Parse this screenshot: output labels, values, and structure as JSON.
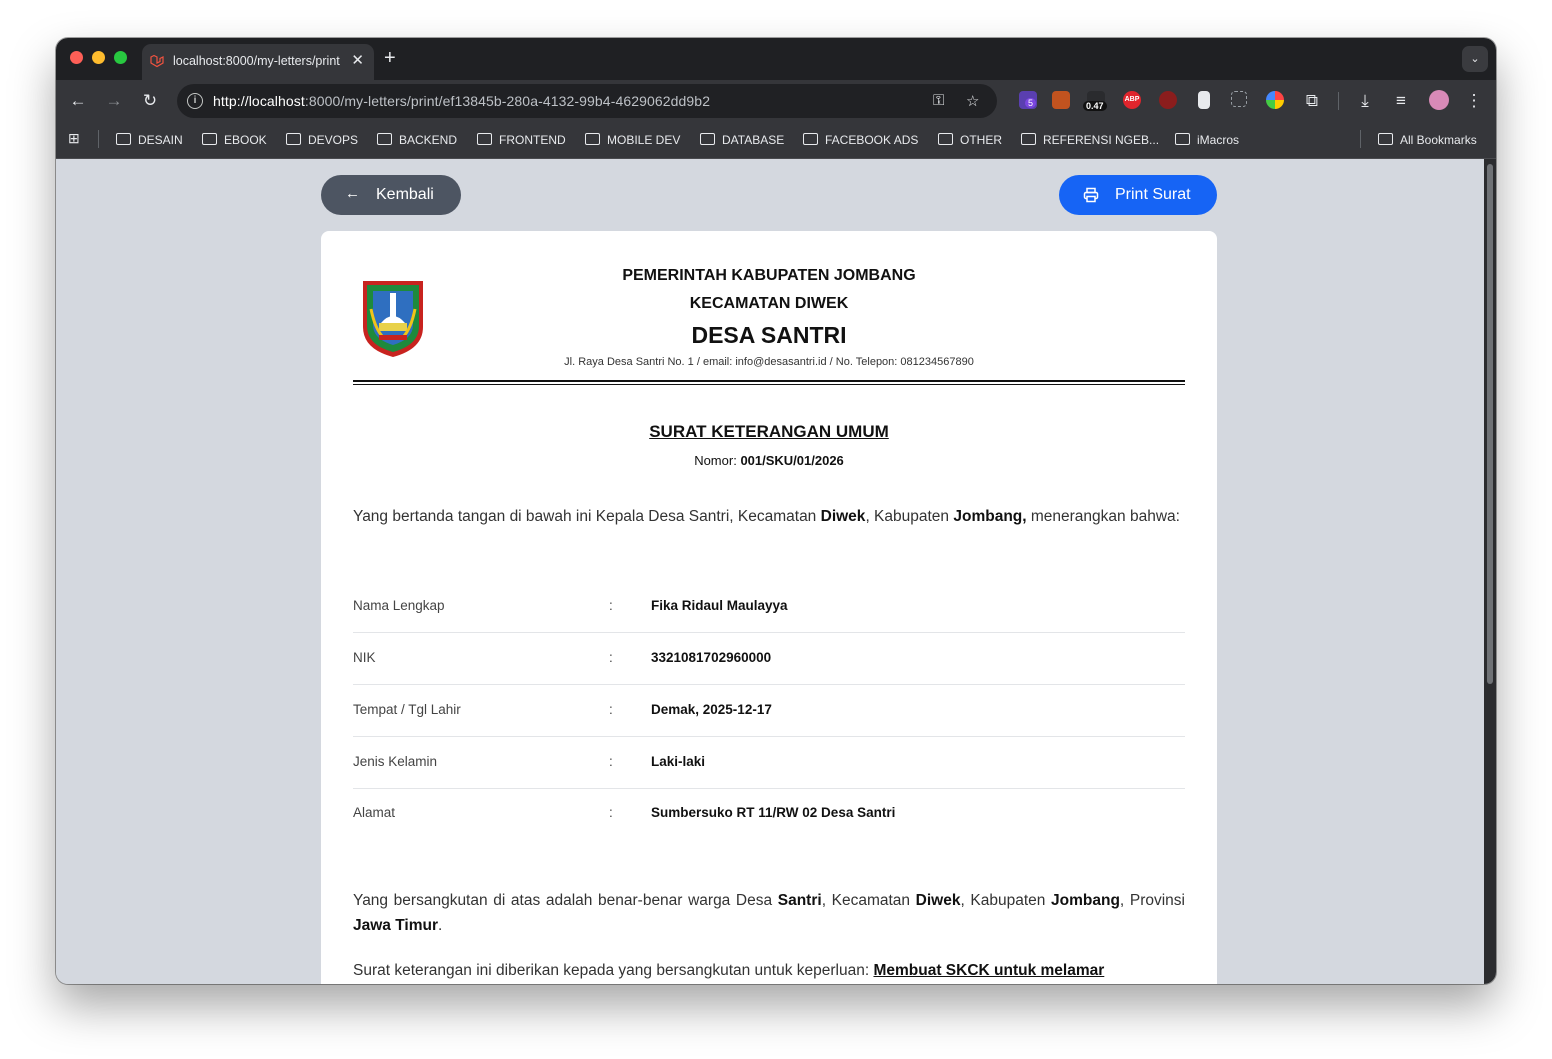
{
  "browser": {
    "tab_title": "localhost:8000/my-letters/print/ef13845b-280a-4132-99b4-4629062dd9b2",
    "url_host": "http://localhost",
    "url_path": ":8000/my-letters/print/ef13845b-280a-4132-99b4-4629062dd9b2",
    "extension_badges": {
      "shield_count": "5",
      "counter_value": "0.47",
      "abp_label": "ABP"
    },
    "bookmarks": [
      "DESAIN",
      "EBOOK",
      "DEVOPS",
      "BACKEND",
      "FRONTEND",
      "MOBILE DEV",
      "DATABASE",
      "FACEBOOK ADS",
      "OTHER",
      "REFERENSI NGEB...",
      "iMacros"
    ],
    "all_bookmarks_label": "All Bookmarks"
  },
  "actions": {
    "back_label": "Kembali",
    "print_label": "Print Surat",
    "print_color": "#1664f5",
    "back_color": "#4d5562"
  },
  "letterhead": {
    "line1": "PEMERINTAH KABUPATEN JOMBANG",
    "line2": "KECAMATAN DIWEK",
    "line3": "DESA SANTRI",
    "address": "Jl. Raya Desa Santri No. 1 / email: info@desasantri.id / No. Telepon: 081234567890"
  },
  "document": {
    "title": "SURAT KETERANGAN UMUM",
    "number_label": "Nomor:",
    "number_value": "001/SKU/01/2026",
    "intro": {
      "t1": "Yang bertanda tangan di bawah ini Kepala Desa Santri, Kecamatan ",
      "b1": "Diwek",
      "t2": ", Kabupaten ",
      "b2": "Jombang,",
      "t3": " menerangkan bahwa:"
    },
    "fields": [
      {
        "label": "Nama Lengkap",
        "value": "Fika Ridaul Maulayya"
      },
      {
        "label": "NIK",
        "value": "3321081702960000"
      },
      {
        "label": "Tempat / Tgl Lahir",
        "value": "Demak, 2025-12-17"
      },
      {
        "label": "Jenis Kelamin",
        "value": "Laki-laki"
      },
      {
        "label": "Alamat",
        "value": "Sumbersuko RT 11/RW 02 Desa Santri"
      }
    ],
    "colon": ":",
    "statement": {
      "t1": "Yang bersangkutan di atas adalah benar-benar warga Desa ",
      "b1": "Santri",
      "t2": ", Kecamatan ",
      "b2": "Diwek",
      "t3": ", Kabupaten ",
      "b3": "Jombang",
      "t4": ", Provinsi ",
      "b4": "Jawa Timur",
      "t5": "."
    },
    "purpose": {
      "t1": "Surat keterangan ini diberikan kepada yang bersangkutan untuk keperluan: ",
      "value": "Membuat SKCK untuk melamar"
    }
  }
}
